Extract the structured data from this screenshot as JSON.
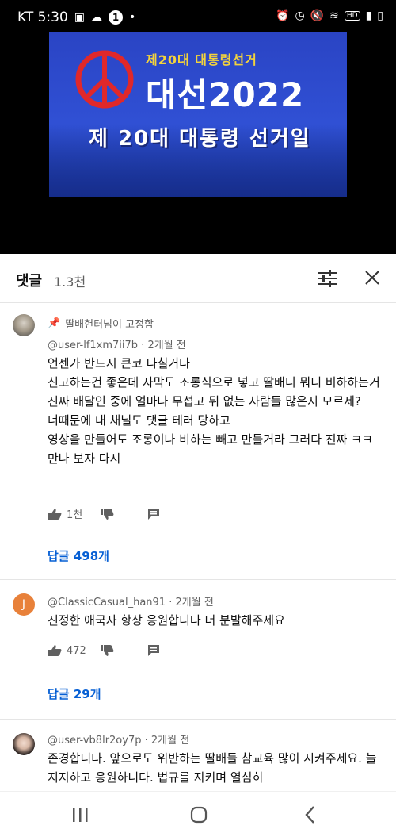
{
  "status_bar": {
    "carrier_time": "KT 5:30",
    "notification_count": "1",
    "hd_label": "HD"
  },
  "video": {
    "subtitle": "제20대 대통령선거",
    "title": "대선2022",
    "banner": "제 20대 대통령 선거일"
  },
  "comments_header": {
    "title": "댓글",
    "count": "1.3천"
  },
  "comments": [
    {
      "pinned_label": "딸배헌터님이 고정함",
      "author": "@user-lf1xm7ii7b",
      "time": "2개월 전",
      "text": "언젠가 반드시 큰코 다칠거다\n신고하는건 좋은데 자막도 조롱식으로 넣고 딸배니 뭐니 비하하는거 진짜 배달인 중에 얼마나 무섭고 뒤 없는 사람들 많은지 모르제?\n너때문에 내 채널도 댓글 테러 당하고\n영상을 만들어도 조롱이나 비하는 빼고 만들거라 그러다 진짜 ㅋㅋ만나 보자 다시",
      "likes": "1천",
      "replies": "답글 498개"
    },
    {
      "avatar_letter": "J",
      "author": "@ClassicCasual_han91",
      "time": "2개월 전",
      "text": "진정한 애국자 항상 응원합니다 더 분발해주세요",
      "likes": "472",
      "replies": "답글 29개"
    },
    {
      "author": "@user-vb8lr2oy7p",
      "time": "2개월 전",
      "text": "존경합니다. 앞으로도 위반하는 딸배들 참교육 많이 시켜주세요. 늘지지하고 응원하니다. 법규를 지키며 열심히"
    }
  ]
}
